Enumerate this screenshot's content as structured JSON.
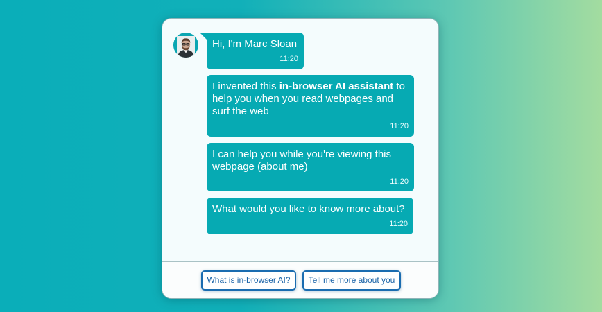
{
  "chat": {
    "avatar_icon": "person-portrait-icon",
    "messages": [
      {
        "parts": [
          "Hi, I'm Marc Sloan"
        ],
        "time": "11:20"
      },
      {
        "before": "I invented this ",
        "bold": "in-browser AI assistant",
        "after": " to help you when you read webpages and surf the web",
        "time": "11:20"
      },
      {
        "text": "I can help you while you're viewing this webpage (about me)",
        "time": "11:20"
      },
      {
        "text": "What would you like to know more about?",
        "time": "11:20"
      }
    ]
  },
  "suggestions": [
    {
      "label": "What is in-browser AI?"
    },
    {
      "label": "Tell me more about you"
    }
  ],
  "colors": {
    "bubble": "#06aab3",
    "chip_border": "#1a6cb0",
    "panel_background": "#f4fcfd"
  }
}
